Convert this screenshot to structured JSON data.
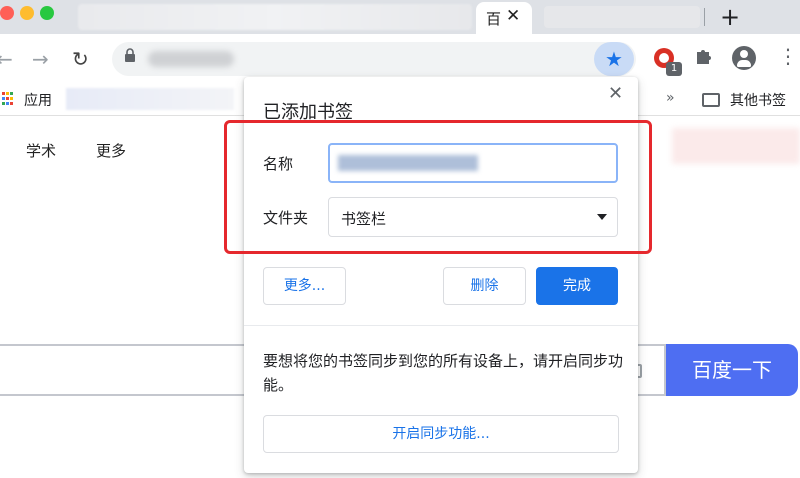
{
  "tabstrip": {
    "active_tab_title": "百",
    "tab_close_glyph": "✕",
    "new_tab_glyph": "+"
  },
  "toolbar": {
    "back_glyph": "←",
    "forward_glyph": "→",
    "reload_glyph": "↻",
    "star_glyph": "★",
    "extension_badge": "1",
    "menu_glyph": "⋮"
  },
  "bookmarks_bar": {
    "apps_label": "应用",
    "overflow_glyph": "»",
    "other_bookmarks_label": "其他书签"
  },
  "page": {
    "links": [
      "学术",
      "更多"
    ],
    "search_button_label": "百度一下"
  },
  "dialog": {
    "title": "已添加书签",
    "close_glyph": "✕",
    "name_label": "名称",
    "folder_label": "文件夹",
    "folder_value": "书签栏",
    "more_button": "更多...",
    "delete_button": "删除",
    "done_button": "完成",
    "sync_message": "要想将您的书签同步到您的所有设备上，请开启同步功能。",
    "sync_button": "开启同步功能..."
  },
  "colors": {
    "accent_blue": "#1a73e8",
    "highlight_red": "#e5282d",
    "search_button_blue": "#4e6ef2"
  },
  "icons": [
    "lock-icon",
    "star-icon",
    "extension-icon",
    "puzzle-icon",
    "profile-icon",
    "apps-icon",
    "folder-icon",
    "camera-icon"
  ]
}
